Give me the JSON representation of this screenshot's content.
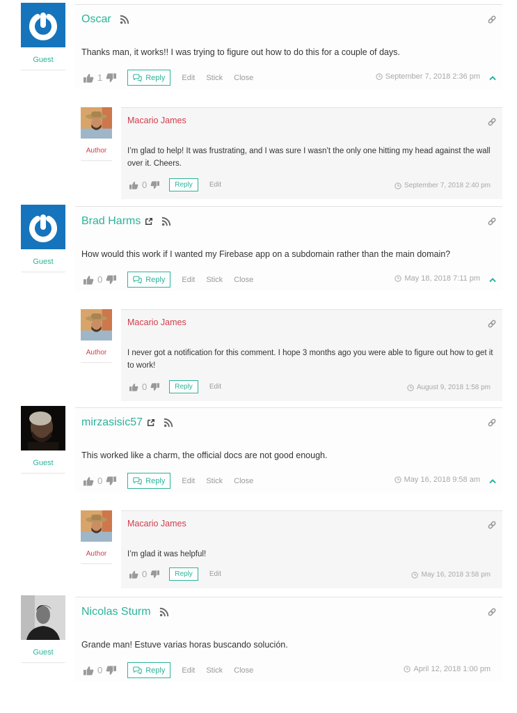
{
  "colors": {
    "accent": "#2bb39a",
    "author": "#d23c4b",
    "muted": "#a8a8a8"
  },
  "threads": [
    {
      "main": {
        "author": "Oscar",
        "role": "Guest",
        "avatar": "gravatar-default",
        "has_website_link": false,
        "text": "Thanks man, it works!! I was trying to figure out how to do this for a couple of days.",
        "votes": "1",
        "actions": {
          "reply": "Reply",
          "edit": "Edit",
          "stick": "Stick",
          "close": "Close"
        },
        "timestamp": "September 7, 2018 2:36 pm"
      },
      "reply": {
        "author": "Macario James",
        "role": "Author",
        "text": "I’m glad to help! It was frustrating, and I was sure I wasn’t the only one hitting my head against the wall over it. Cheers.",
        "votes": "0",
        "actions": {
          "reply": "Reply",
          "edit": "Edit"
        },
        "timestamp": "September 7, 2018 2:40 pm"
      }
    },
    {
      "main": {
        "author": "Brad Harms",
        "role": "Guest",
        "avatar": "gravatar-default",
        "has_website_link": true,
        "text": "How would this work if I wanted my Firebase app on a subdomain rather than the main domain?",
        "votes": "0",
        "actions": {
          "reply": "Reply",
          "edit": "Edit",
          "stick": "Stick",
          "close": "Close"
        },
        "timestamp": "May 18, 2018 7:11 pm"
      },
      "reply": {
        "author": "Macario James",
        "role": "Author",
        "text": "I never got a notification for this comment. I hope 3 months ago you were able to figure out how to get it to work!",
        "votes": "0",
        "actions": {
          "reply": "Reply",
          "edit": "Edit"
        },
        "timestamp": "August 9, 2018 1:58 pm"
      }
    },
    {
      "main": {
        "author": "mirzasisic57",
        "role": "Guest",
        "avatar": "photo-dark",
        "has_website_link": true,
        "text": "This worked like a charm, the official docs are not good enough.",
        "votes": "0",
        "actions": {
          "reply": "Reply",
          "edit": "Edit",
          "stick": "Stick",
          "close": "Close"
        },
        "timestamp": "May 16, 2018 9:58 am"
      },
      "reply": {
        "author": "Macario James",
        "role": "Author",
        "text": "I’m glad it was helpful!",
        "votes": "0",
        "actions": {
          "reply": "Reply",
          "edit": "Edit"
        },
        "timestamp": "May 16, 2018 3:58 pm"
      }
    },
    {
      "main": {
        "author": "Nicolas Sturm",
        "role": "Guest",
        "avatar": "photo-bw",
        "has_website_link": false,
        "text": "Grande man! Estuve varias horas buscando solución.",
        "votes": "0",
        "actions": {
          "reply": "Reply",
          "edit": "Edit",
          "stick": "Stick",
          "close": "Close"
        },
        "timestamp": "April 12, 2018 1:00 pm"
      }
    }
  ]
}
